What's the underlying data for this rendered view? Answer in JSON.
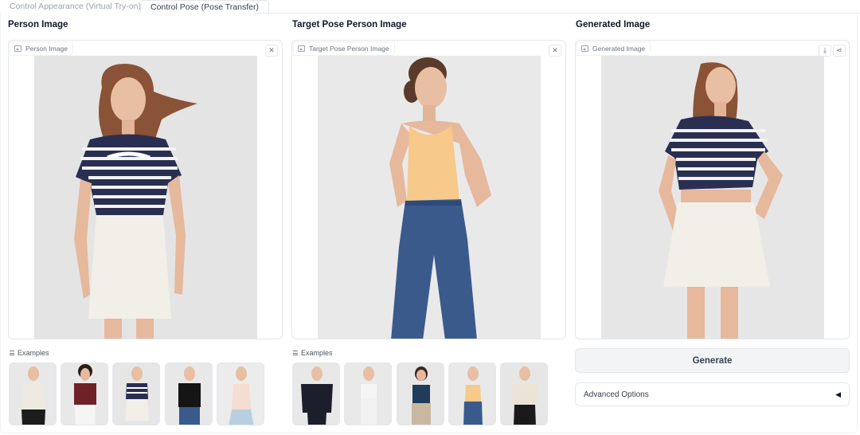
{
  "tabs": [
    {
      "label": "Control Appearance (Virtual Try-on)",
      "active": false
    },
    {
      "label": "Control Pose (Pose Transfer)",
      "active": true
    }
  ],
  "columns": {
    "person": {
      "title": "Person Image",
      "panel_label": "Person Image"
    },
    "target": {
      "title": "Target Pose Person Image",
      "panel_label": "Target Pose Person Image"
    },
    "generated": {
      "title": "Generated Image",
      "panel_label": "Generated Image"
    }
  },
  "icons": {
    "clear": "close-icon",
    "download": "download-icon",
    "share": "share-icon",
    "image": "image-icon",
    "examples": "list-icon"
  },
  "glyphs": {
    "close": "✕",
    "download": "⤓",
    "share": "⋖"
  },
  "examples_label": "Examples",
  "generate_label": "Generate",
  "advanced_label": "Advanced Options",
  "advanced_indicator": "◀",
  "colors": {
    "navy_stripe": "#2a2f52",
    "peach_top": "#f7c98a",
    "denim": "#3a5a8c",
    "white_skirt": "#f1efe8",
    "skin": "#e6b89c",
    "hair": "#8a5236",
    "photo_bg": "#e7e7e7"
  }
}
